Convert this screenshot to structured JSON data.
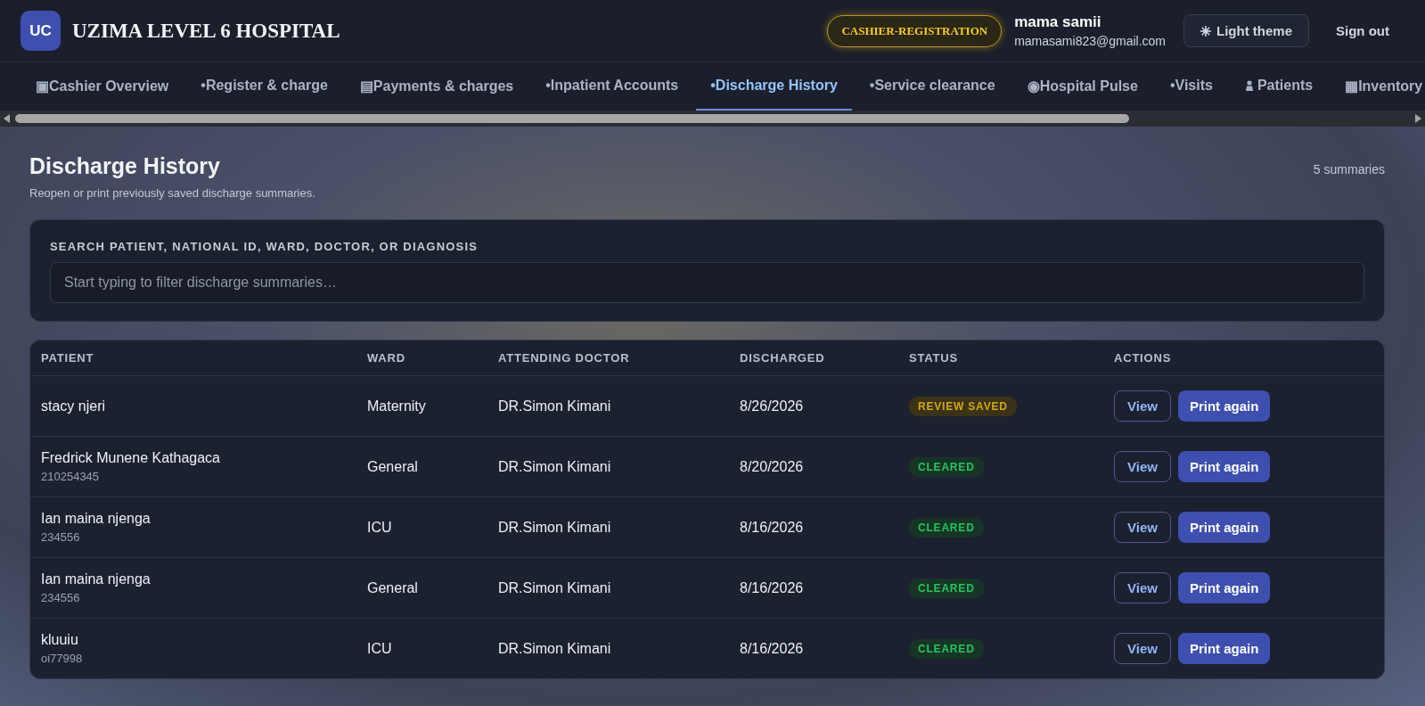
{
  "header": {
    "logo": "UC",
    "title": "UZIMA LEVEL 6 HOSPITAL",
    "role_badge": "CASHIER-REGISTRATION",
    "user": {
      "name": "mama samii",
      "email": "mamasami823@gmail.com"
    },
    "theme_button": "Light theme",
    "sign_out": "Sign out"
  },
  "nav": [
    {
      "label": "▣Cashier Overview",
      "kind": "text",
      "selected": false
    },
    {
      "label": "•Register & charge",
      "kind": "text",
      "selected": false
    },
    {
      "label": "▤Payments & charges",
      "kind": "text",
      "selected": false
    },
    {
      "label": "•Inpatient Accounts",
      "kind": "text",
      "selected": false
    },
    {
      "label": "•Discharge History",
      "kind": "text",
      "selected": true
    },
    {
      "label": "•Service clearance",
      "kind": "text",
      "selected": false
    },
    {
      "label": "◉Hospital Pulse",
      "kind": "text",
      "selected": false
    },
    {
      "label": "•Visits",
      "kind": "text",
      "selected": false
    },
    {
      "label": "Patients",
      "kind": "person",
      "selected": false
    },
    {
      "label": "▦Inventory",
      "kind": "text",
      "selected": false
    }
  ],
  "page": {
    "title": "Discharge History",
    "subtitle": "Reopen or print previously saved discharge summaries.",
    "count": "5 summaries"
  },
  "search": {
    "label": "SEARCH PATIENT, NATIONAL ID, WARD, DOCTOR, OR DIAGNOSIS",
    "placeholder": "Start typing to filter discharge summaries…"
  },
  "table": {
    "columns": [
      "PATIENT",
      "WARD",
      "ATTENDING DOCTOR",
      "DISCHARGED",
      "STATUS",
      "ACTIONS"
    ],
    "rows": [
      {
        "patient": "stacy njeri",
        "id": "",
        "ward": "Maternity",
        "doctor": "DR.Simon Kimani",
        "discharged": "8/26/2026",
        "status": "REVIEW SAVED",
        "kind": "review",
        "actions": [
          "View",
          "Print again"
        ]
      },
      {
        "patient": "Fredrick Munene Kathagaca",
        "id": "210254345",
        "ward": "General",
        "doctor": "DR.Simon Kimani",
        "discharged": "8/20/2026",
        "status": "CLEARED",
        "kind": "cleared",
        "actions": [
          "View",
          "Print again"
        ]
      },
      {
        "patient": "Ian maina njenga",
        "id": "234556",
        "ward": "ICU",
        "doctor": "DR.Simon Kimani",
        "discharged": "8/16/2026",
        "status": "CLEARED",
        "kind": "cleared",
        "actions": [
          "View",
          "Print again"
        ]
      },
      {
        "patient": "Ian maina njenga",
        "id": "234556",
        "ward": "General",
        "doctor": "DR.Simon Kimani",
        "discharged": "8/16/2026",
        "status": "CLEARED",
        "kind": "cleared",
        "actions": [
          "View",
          "Print again"
        ]
      },
      {
        "patient": "kluuiu",
        "id": "oi77998",
        "ward": "ICU",
        "doctor": "DR.Simon Kimani",
        "discharged": "8/16/2026",
        "status": "CLEARED",
        "kind": "cleared",
        "actions": [
          "View",
          "Print again"
        ]
      }
    ]
  }
}
